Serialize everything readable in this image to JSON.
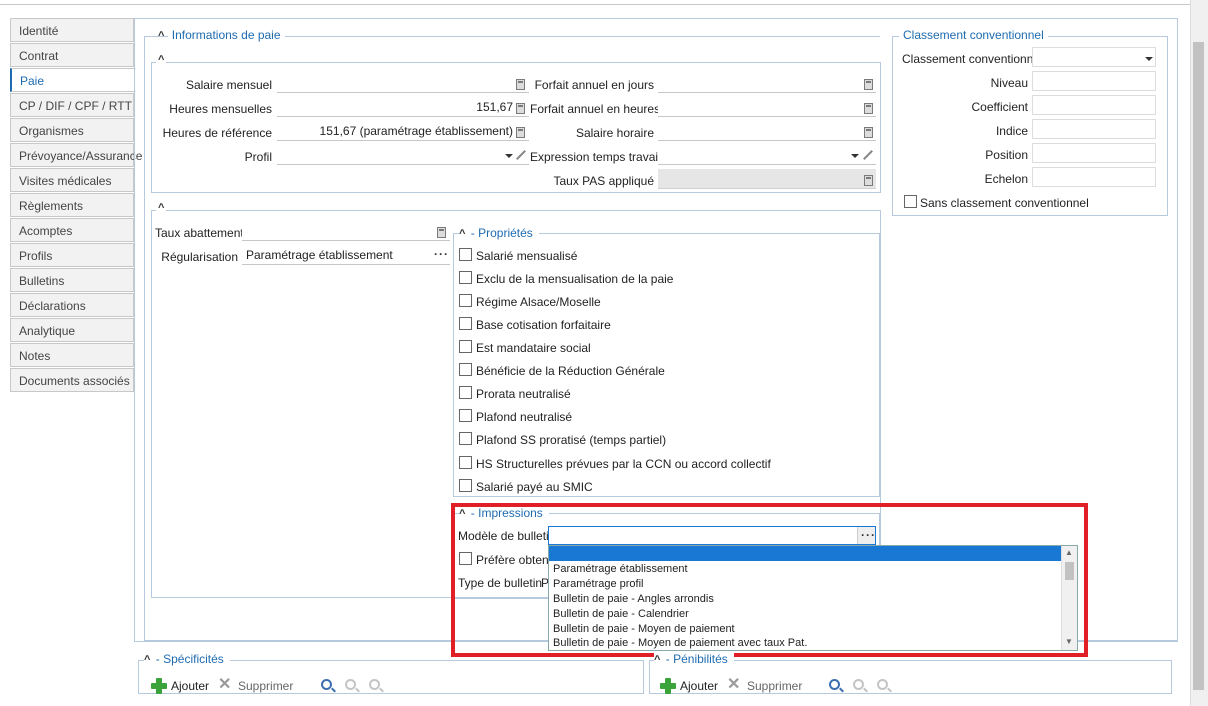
{
  "tabs": [
    "Identité",
    "Contrat",
    "Paie",
    "CP / DIF / CPF / RTT",
    "Organismes",
    "Prévoyance/Assurance",
    "Visites médicales",
    "Règlements",
    "Acomptes",
    "Profils",
    "Bulletins",
    "Déclarations",
    "Analytique",
    "Notes",
    "Documents associés"
  ],
  "active_tab": "Paie",
  "info_paie": {
    "title": "Informations de paie",
    "salaire_mensuel_label": "Salaire mensuel",
    "salaire_mensuel_value": "",
    "heures_mensuelles_label": "Heures mensuelles",
    "heures_mensuelles_value": "151,67",
    "heures_reference_label": "Heures de référence",
    "heures_reference_value": "151,67 (paramétrage établissement)",
    "profil_label": "Profil",
    "forfait_jours_label": "Forfait annuel en jours",
    "forfait_heures_label": "Forfait annuel en heures",
    "salaire_horaire_label": "Salaire horaire",
    "expression_temps_label": "Expression temps travail",
    "taux_pas_label": "Taux PAS appliqué"
  },
  "abattement": {
    "taux_label": "Taux abattement",
    "regularisation_label": "Régularisation",
    "regularisation_value": "Paramétrage établissement"
  },
  "proprietes": {
    "title": "- Propriétés",
    "items": [
      "Salarié mensualisé",
      "Exclu de la mensualisation de la paie",
      "Régime Alsace/Moselle",
      "Base cotisation forfaitaire",
      "Est mandataire social",
      "Bénéficie de la Réduction Générale",
      "Prorata neutralisé",
      "Plafond neutralisé",
      "Plafond SS proratisé (temps partiel)",
      "HS Structurelles prévues par la CCN ou accord collectif",
      "Salarié payé au SMIC"
    ]
  },
  "impressions": {
    "title": "- Impressions",
    "modele_label": "Modèle de bulletin",
    "prefere_label": "Préfère obtenir",
    "type_label": "Type de bulletin",
    "type_value": "P",
    "dropdown_options": [
      "Paramétrage établissement",
      "Paramétrage profil",
      "Bulletin de paie - Angles arrondis",
      "Bulletin de paie - Calendrier",
      "Bulletin de paie - Moyen de paiement",
      "Bulletin de paie - Moyen de paiement avec taux Pat."
    ]
  },
  "classement": {
    "title": "Classement conventionnel",
    "classement_label": "Classement conventionnel",
    "niveau_label": "Niveau",
    "coefficient_label": "Coefficient",
    "indice_label": "Indice",
    "position_label": "Position",
    "echelon_label": "Echelon",
    "sans_label": "Sans classement conventionnel"
  },
  "specificites": {
    "title": "- Spécificités",
    "ajouter": "Ajouter",
    "supprimer": "Supprimer"
  },
  "penibilites": {
    "title": "- Pénibilités",
    "ajouter": "Ajouter",
    "supprimer": "Supprimer"
  }
}
